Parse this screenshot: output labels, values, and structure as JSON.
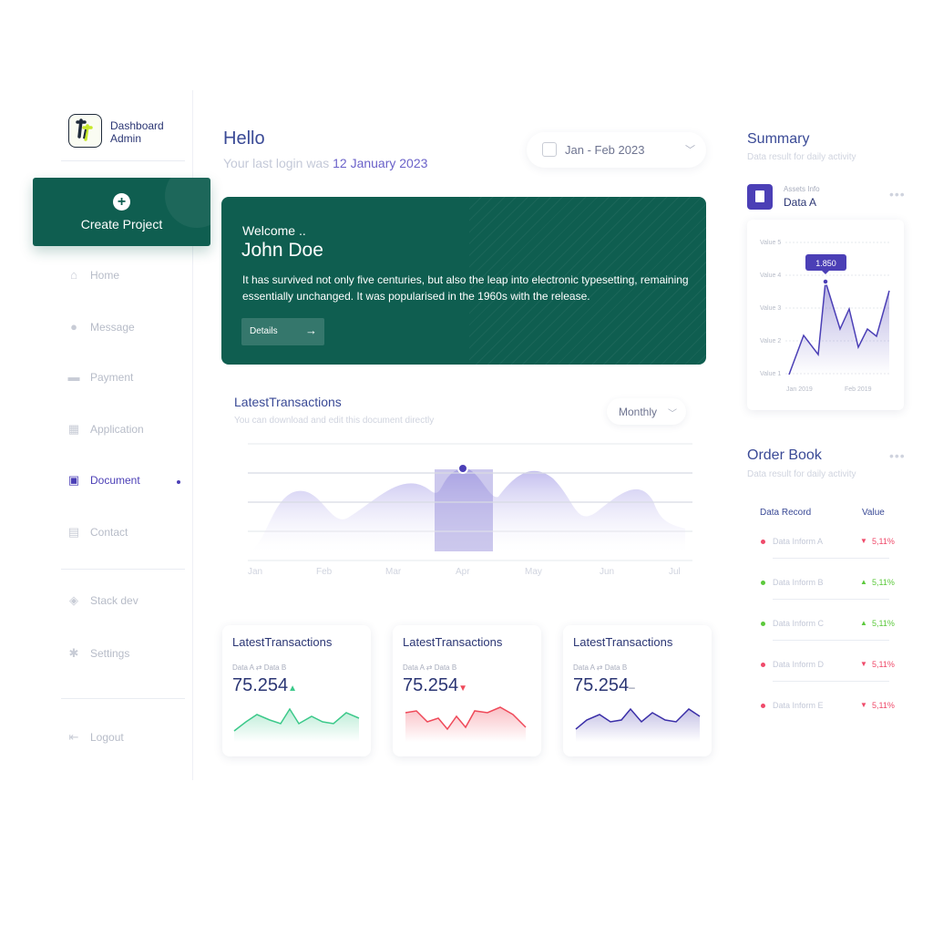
{
  "app": {
    "logo_title": "Dashboard",
    "logo_subtitle": "Admin"
  },
  "sidebar": {
    "create_label": "Create Project",
    "items": [
      {
        "label": "Home",
        "icon": "home-icon"
      },
      {
        "label": "Message",
        "icon": "message-icon"
      },
      {
        "label": "Payment",
        "icon": "payment-icon"
      },
      {
        "label": "Application",
        "icon": "application-icon"
      },
      {
        "label": "Document",
        "icon": "document-icon",
        "active": true
      },
      {
        "label": "Contact",
        "icon": "contact-icon"
      },
      {
        "label": "Stack dev",
        "icon": "layers-icon"
      },
      {
        "label": "Settings",
        "icon": "gear-icon"
      },
      {
        "label": "Logout",
        "icon": "logout-icon"
      }
    ]
  },
  "header": {
    "greeting": "Hello",
    "last_login_prefix": "Your last login was",
    "last_login_date": "12 January 2023",
    "date_range": "Jan - Feb 2023"
  },
  "banner": {
    "welcome": "Welcome ..",
    "name": "John Doe",
    "text": "It has survived not only five centuries, but also the leap into electronic typesetting, remaining essentially unchanged. It was popularised in the 1960s with the release.",
    "button": "Details"
  },
  "transactions": {
    "title": "LatestTransactions",
    "subtitle": "You can download and edit this document directly",
    "period": "Monthly",
    "chart_data": {
      "type": "area",
      "categories": [
        "Jan",
        "Feb",
        "Mar",
        "Apr",
        "May",
        "Jun",
        "Jul"
      ],
      "highlighted": "Apr"
    }
  },
  "cards": [
    {
      "title": "LatestTransactions",
      "label_a": "Data A",
      "label_b": "Data B",
      "value": "75.254",
      "trend": "up",
      "color": "#3cc98a"
    },
    {
      "title": "LatestTransactions",
      "label_a": "Data A",
      "label_b": "Data B",
      "value": "75.254",
      "trend": "down",
      "color": "#ef4a5a"
    },
    {
      "title": "LatestTransactions",
      "label_a": "Data A",
      "label_b": "Data B",
      "value": "75.254",
      "trend": "flat",
      "color": "#3b2fa8"
    }
  ],
  "summary": {
    "title": "Summary",
    "subtitle": "Data result for daily activity",
    "assets_label": "Assets Info",
    "assets_value": "Data A",
    "chart_data": {
      "type": "line",
      "y_ticks": [
        "Value 5",
        "Value 4",
        "Value 3",
        "Value 2",
        "Value 1"
      ],
      "x_ticks": [
        "Jan 2019",
        "Feb 2019"
      ],
      "tooltip": "1.850"
    }
  },
  "order_book": {
    "title": "Order Book",
    "subtitle": "Data result for daily activity",
    "col_record": "Data Record",
    "col_value": "Value",
    "rows": [
      {
        "name": "Data Inform A",
        "value": "5,11%",
        "trend": "down",
        "color": "#ef4a6a"
      },
      {
        "name": "Data Inform B",
        "value": "5,11%",
        "trend": "up",
        "color": "#5cc93c"
      },
      {
        "name": "Data Inform C",
        "value": "5,11%",
        "trend": "up",
        "color": "#5cc93c"
      },
      {
        "name": "Data Inform D",
        "value": "5,11%",
        "trend": "down",
        "color": "#ef4a6a"
      },
      {
        "name": "Data Inform E",
        "value": "5,11%",
        "trend": "down",
        "color": "#ef4a6a"
      }
    ]
  }
}
